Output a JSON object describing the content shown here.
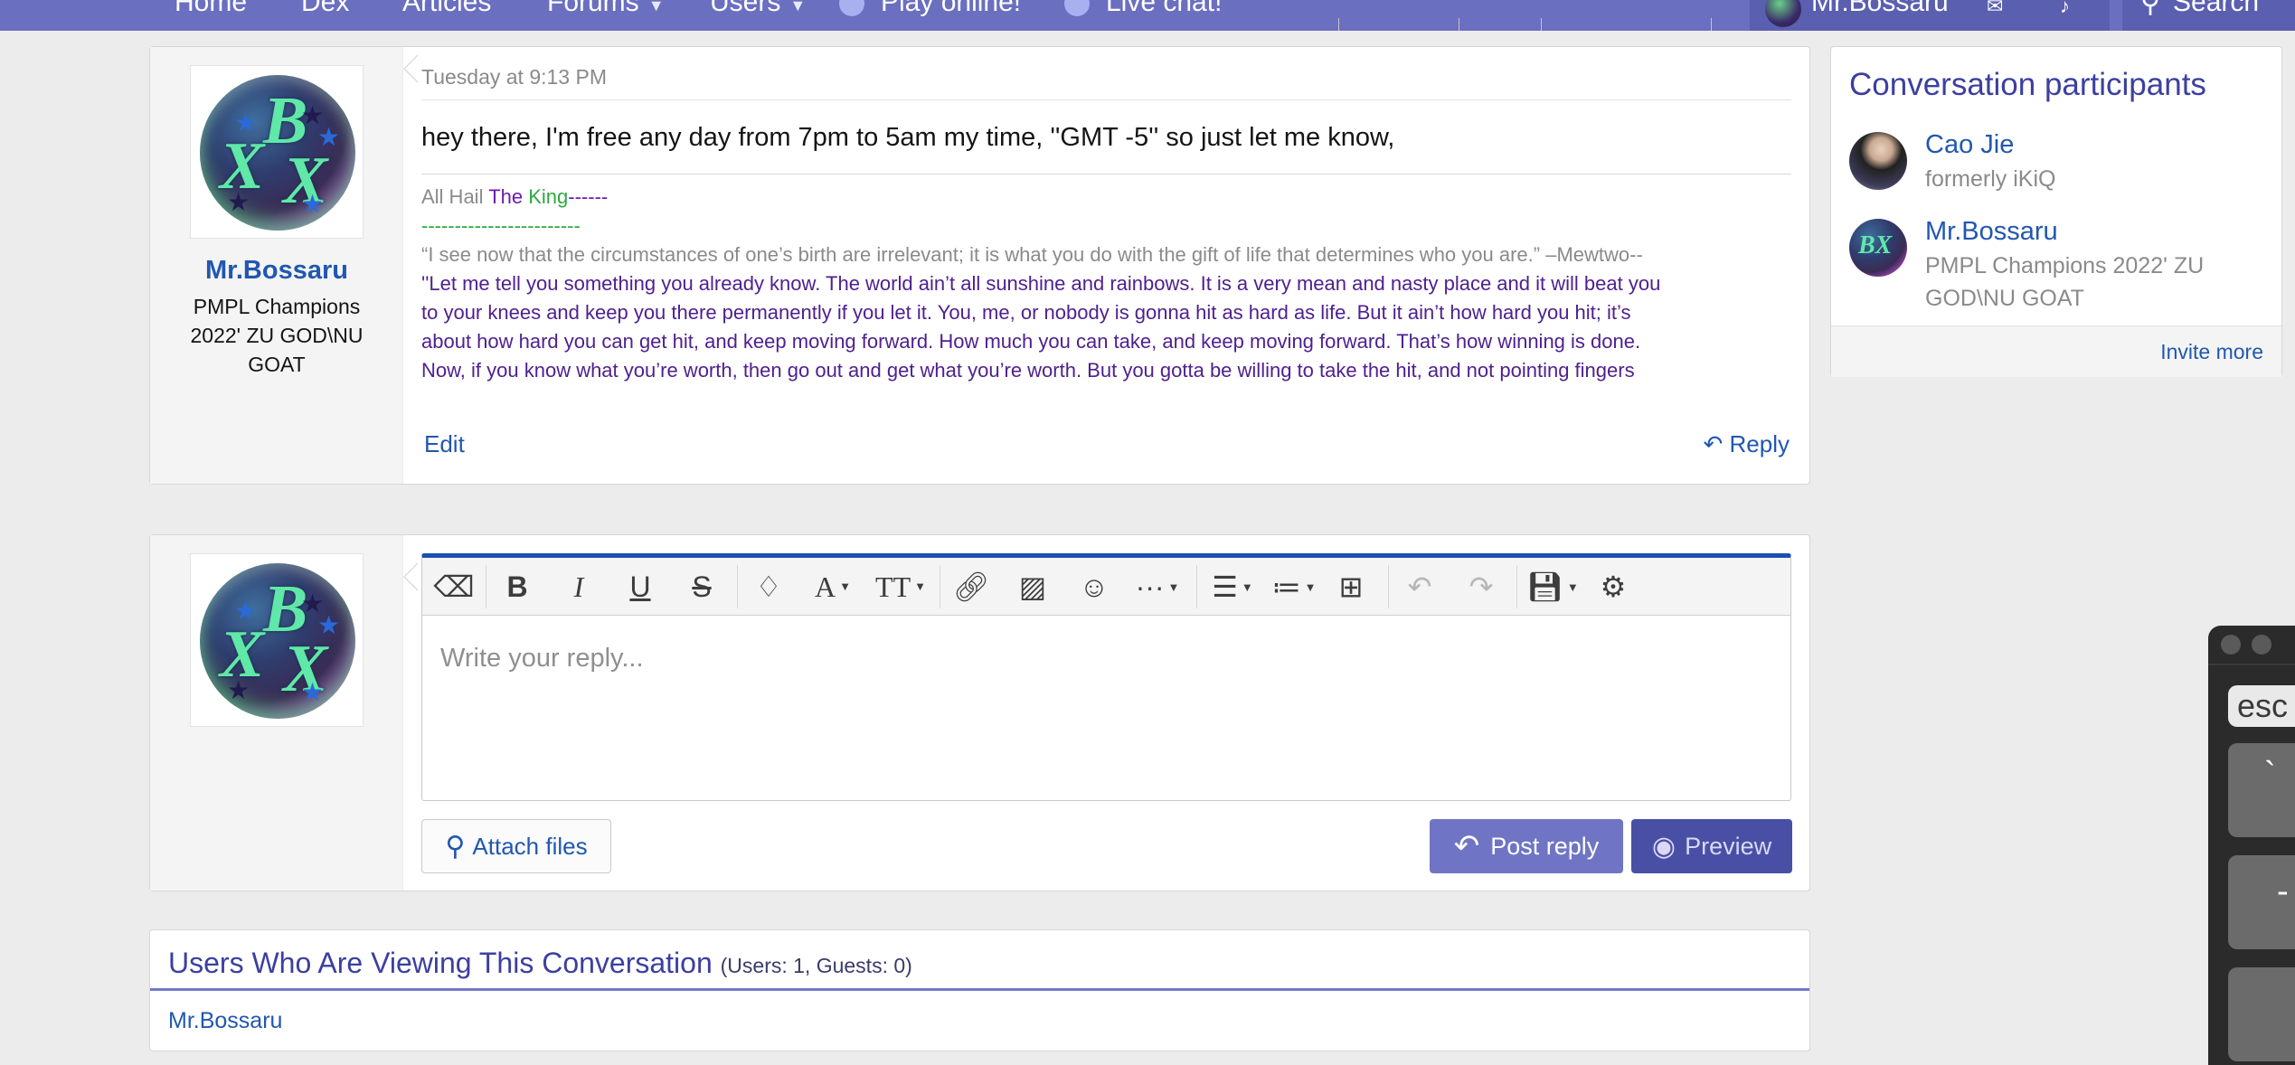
{
  "nav": {
    "items": [
      "Home",
      "Dex",
      "Articles",
      "Forums",
      "Users"
    ],
    "play": "Play online!",
    "chat": "Live chat!",
    "username": "Mr.Bossaru",
    "search": "Search"
  },
  "message": {
    "date": "Tuesday at 9:13 PM",
    "author": "Mr.Bossaru",
    "author_title": "PMPL Champions 2022' ZU GOD\\NU GOAT",
    "body": "hey there, I'm free any day from 7pm to 5am my time, ''GMT -5'' so just let me know,",
    "signature": {
      "line1_a": "All Hail ",
      "line1_b": "The ",
      "line1_c": "King",
      "line1_d": "------",
      "line2": "------------------------",
      "quote1": "“I see now that the circumstances of one’s birth are irrelevant; it is what you do with the gift of life that determines who you are.” –Mewtwo--",
      "quote2_l1": "''Let me tell you something you already know. The world ain’t all sunshine and rainbows. It is a very mean and nasty place and it will beat you",
      "quote2_l2": "to your knees and keep you there permanently if you let it. You, me, or nobody is gonna hit as hard as life. But it ain’t how hard you hit; it’s",
      "quote2_l3": "about how hard you can get hit, and keep moving forward. How much you can take, and keep moving forward. That’s how winning is done.",
      "quote2_l4": "Now, if you know what you’re worth, then go out and get what you’re worth. But you gotta be willing to take the hit, and not pointing fingers"
    },
    "edit_label": "Edit",
    "reply_label": "Reply"
  },
  "reply_box": {
    "placeholder": "Write your reply...",
    "attach_label": "Attach files",
    "post_label": "Post reply",
    "preview_label": "Preview"
  },
  "viewers": {
    "heading": "Users Who Are Viewing This Conversation",
    "count": "(Users: 1, Guests: 0)",
    "users": [
      "Mr.Bossaru"
    ]
  },
  "participants": {
    "heading": "Conversation participants",
    "items": [
      {
        "name": "Cao Jie",
        "sub": "formerly iKiQ"
      },
      {
        "name": "Mr.Bossaru",
        "sub": "PMPL Champions 2022' ZU GOD\\NU GOAT"
      }
    ],
    "invite_label": "Invite more"
  },
  "keyboard": {
    "keys": [
      "esc",
      "`",
      "-",
      ""
    ]
  },
  "colors": {
    "nav_bg": "#6a6fc0",
    "link": "#2157b0",
    "accent": "#3c3fa0",
    "editor_top": "#1b4fb0"
  }
}
